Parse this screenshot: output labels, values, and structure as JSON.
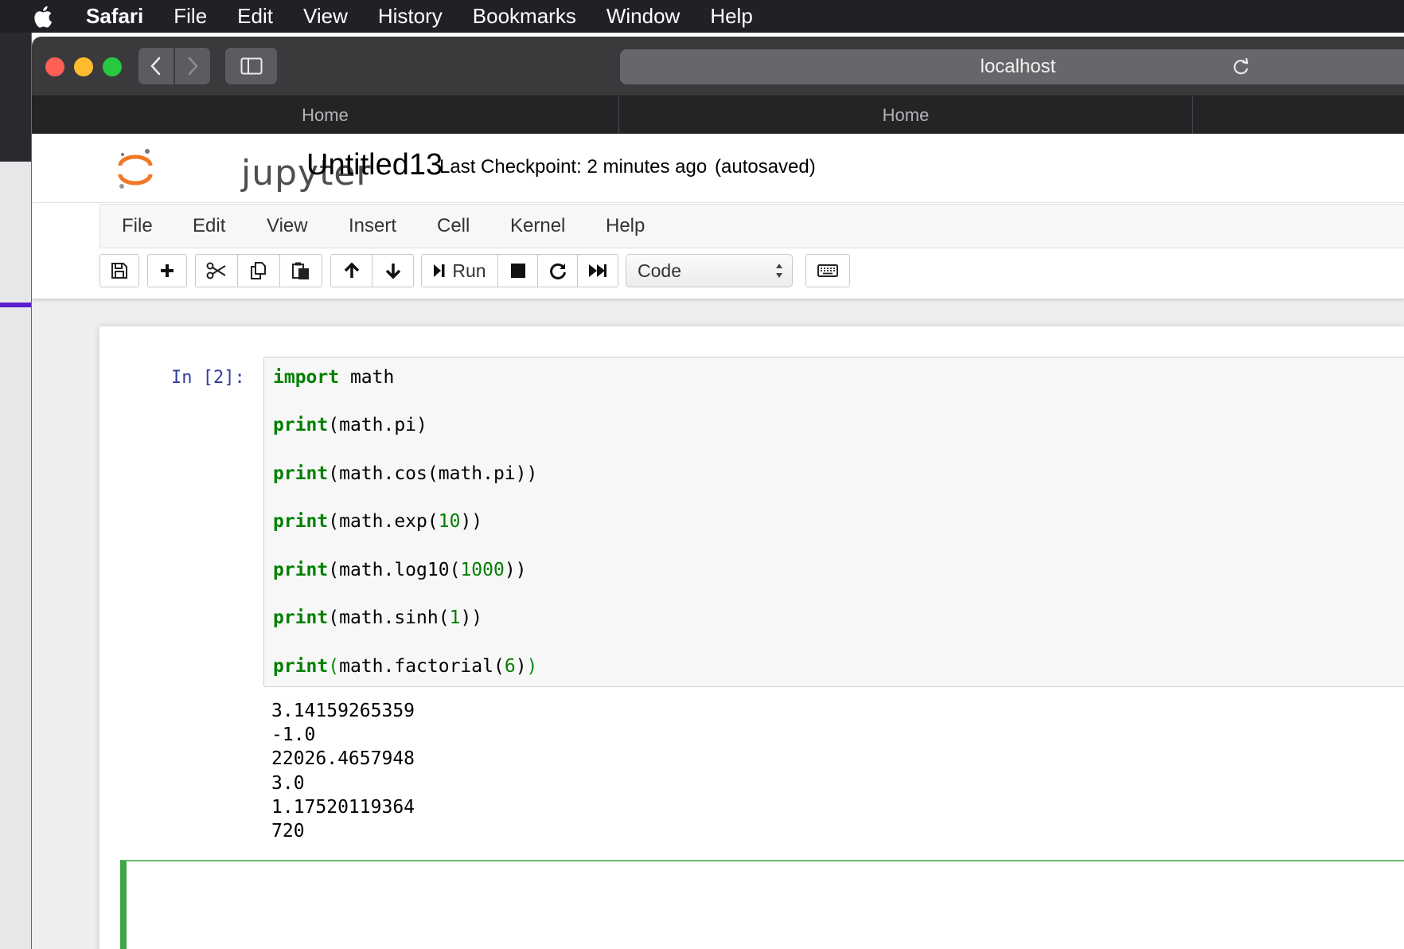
{
  "mac_menubar": {
    "app": "Safari",
    "items": [
      "File",
      "Edit",
      "View",
      "History",
      "Bookmarks",
      "Window",
      "Help"
    ]
  },
  "safari": {
    "url": "localhost",
    "tabs": [
      "Home",
      "Home"
    ]
  },
  "jupyter": {
    "logo_text": "jupyter",
    "notebook_name": "Untitled13",
    "checkpoint": "Last Checkpoint: 2 minutes ago",
    "autosave": "(autosaved)",
    "menu": [
      "File",
      "Edit",
      "View",
      "Insert",
      "Cell",
      "Kernel",
      "Help"
    ],
    "toolbar": {
      "run_label": "Run",
      "cell_type": "Code"
    }
  },
  "cell": {
    "prompt": "In [2]:",
    "output": "3.14159265359\n-1.0\n22026.4657948\n3.0\n1.17520119364\n720"
  },
  "colors": {
    "keyword": "#008000",
    "prompt": "#303f9f",
    "selected_cell_border": "#42a548"
  }
}
